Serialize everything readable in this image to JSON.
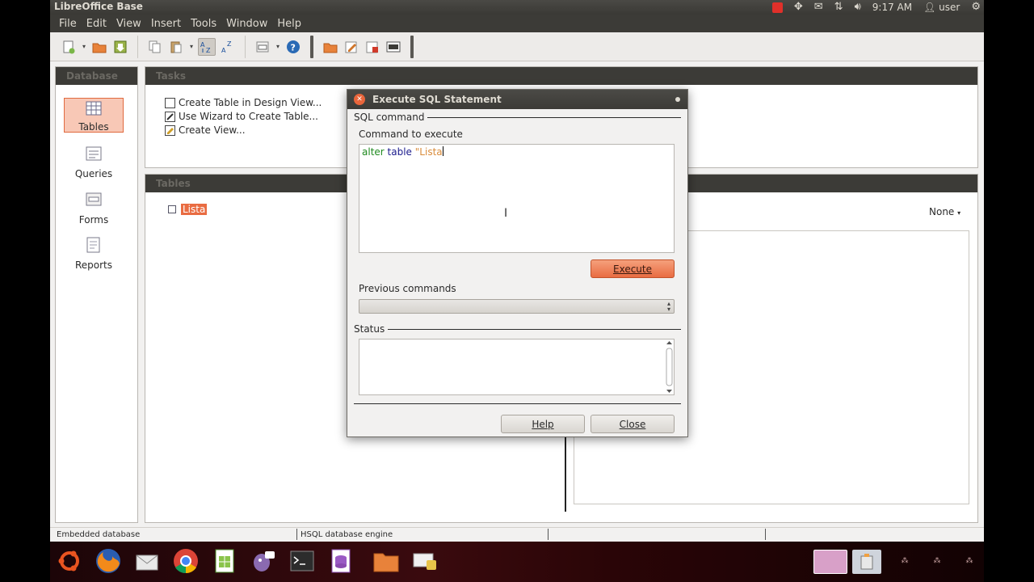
{
  "topbar": {
    "title": "LibreOffice Base",
    "time": "9:17 AM",
    "user": "user"
  },
  "menu": [
    "File",
    "Edit",
    "View",
    "Insert",
    "Tools",
    "Window",
    "Help"
  ],
  "panels": {
    "database": "Database",
    "tasks": "Tasks",
    "tables": "Tables"
  },
  "db_items": [
    "Tables",
    "Queries",
    "Forms",
    "Reports"
  ],
  "tasks": [
    "Create Table in Design View...",
    "Use Wizard to Create Table...",
    "Create View..."
  ],
  "tables_list": [
    "Lista"
  ],
  "preview_option": "None",
  "statusbar": {
    "left": "Embedded database",
    "middle": "HSQL database engine"
  },
  "dialog": {
    "title": "Execute SQL Statement",
    "group_sql": "SQL command",
    "label_command": "Command to execute",
    "sql_kw1": "alter",
    "sql_kw2": "table",
    "sql_str": "\"Lista",
    "execute": "Execute",
    "label_previous": "Previous commands",
    "group_status": "Status",
    "help": "Help",
    "close": "Close"
  },
  "colors": {
    "accent": "#e96c42",
    "panel_dark": "#3c3b37"
  }
}
